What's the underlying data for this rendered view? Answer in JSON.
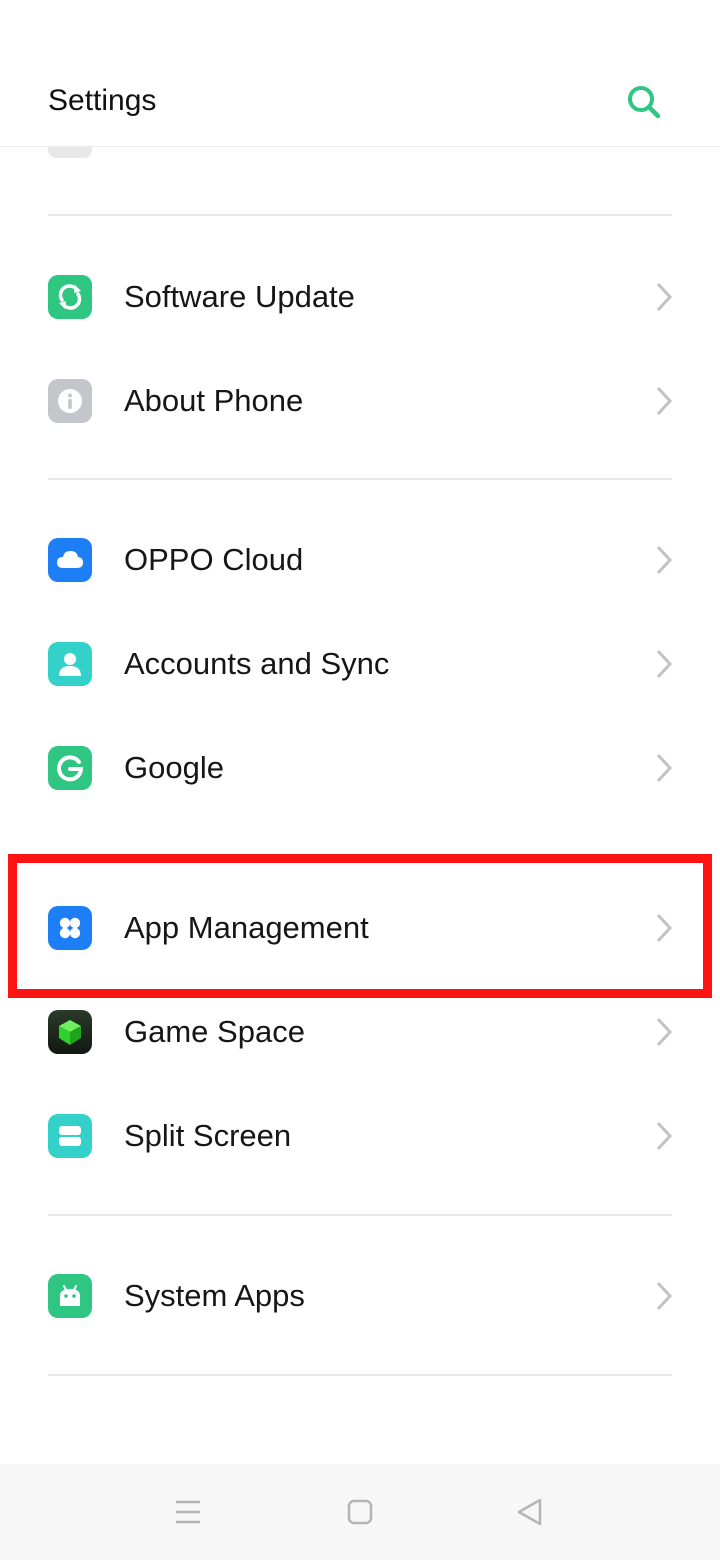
{
  "header": {
    "title": "Settings",
    "search_icon": "search-icon"
  },
  "accent_color": "#2fc681",
  "rows": [
    {
      "label": "Software Update",
      "icon": "refresh-icon",
      "color": "#2fc681"
    },
    {
      "label": "About Phone",
      "icon": "info-icon",
      "color": "#c4c6cc"
    },
    {
      "label": "OPPO Cloud",
      "icon": "cloud-icon",
      "color": "#1e7ef5"
    },
    {
      "label": "Accounts and Sync",
      "icon": "user-icon",
      "color": "#33d1c9"
    },
    {
      "label": "Google",
      "icon": "google-icon",
      "color": "#2fc681"
    },
    {
      "label": "App Management",
      "icon": "app-grid-icon",
      "color": "#1e7ef5"
    },
    {
      "label": "Game Space",
      "icon": "cube-icon",
      "color": "#1d2a1c"
    },
    {
      "label": "Split Screen",
      "icon": "split-screen-icon",
      "color": "#33d1c9"
    },
    {
      "label": "System Apps",
      "icon": "android-icon",
      "color": "#2fc681"
    }
  ],
  "highlight_color": "#ff1414",
  "navbar": {
    "icons": [
      "menu-icon",
      "home-icon",
      "back-icon"
    ]
  }
}
